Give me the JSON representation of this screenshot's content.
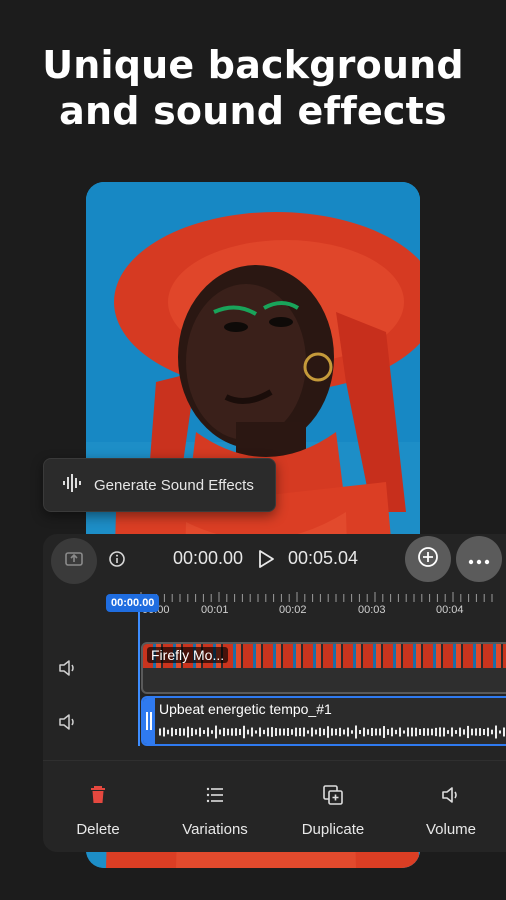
{
  "headline": {
    "line1": "Unique background",
    "line2": "and sound effects"
  },
  "generate_button": {
    "label": "Generate Sound Effects",
    "icon": "waveform-icon"
  },
  "player": {
    "current_time": "00:00.00",
    "total_time": "00:05.04",
    "playhead_badge": "00:00.00"
  },
  "ruler": {
    "ticks": [
      "00:00",
      "00:01",
      "00:02",
      "00:03",
      "00:04"
    ]
  },
  "tracks": [
    {
      "clip_title": "Firefly Mo...",
      "icon": "speaker-icon"
    },
    {
      "clip_title": "Upbeat energetic tempo_#1",
      "icon": "speaker-icon"
    }
  ],
  "actions": [
    {
      "label": "Delete",
      "icon": "trash-icon",
      "color": "#e5483f"
    },
    {
      "label": "Variations",
      "icon": "list-icon"
    },
    {
      "label": "Duplicate",
      "icon": "duplicate-icon"
    },
    {
      "label": "Volume",
      "icon": "speaker-icon"
    }
  ],
  "colors": {
    "accent": "#2f7af0",
    "background": "#1c1c1c",
    "panel": "#242424",
    "delete": "#e5483f"
  }
}
